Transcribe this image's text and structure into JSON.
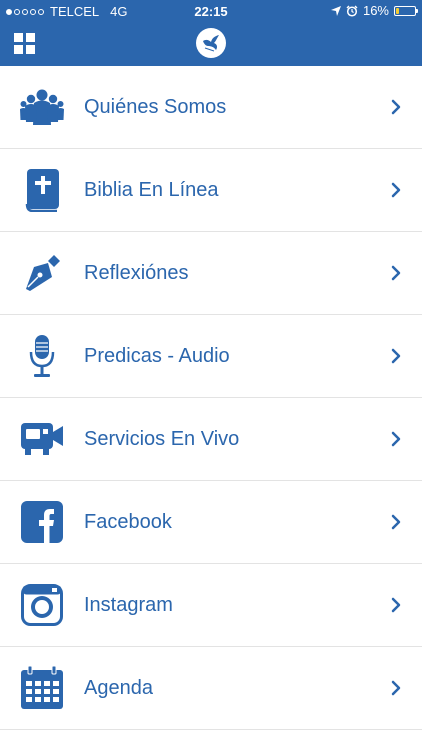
{
  "status_bar": {
    "carrier": "TELCEL",
    "network": "4G",
    "time": "22:15",
    "battery": "16%"
  },
  "header": {
    "menu_icon": "grid-icon",
    "logo_icon": "dove-logo-icon"
  },
  "colors": {
    "brand": "#2b66ad",
    "divider": "#e3e3e3"
  },
  "menu": [
    {
      "label": "Quiénes Somos",
      "icon": "group-icon"
    },
    {
      "label": "Biblia En Línea",
      "icon": "bible-icon"
    },
    {
      "label": "Reflexiónes",
      "icon": "fountain-pen-icon"
    },
    {
      "label": "Predicas - Audio",
      "icon": "microphone-icon"
    },
    {
      "label": "Servicios En Vivo",
      "icon": "video-camera-icon"
    },
    {
      "label": "Facebook",
      "icon": "facebook-icon"
    },
    {
      "label": "Instagram",
      "icon": "instagram-icon"
    },
    {
      "label": "Agenda",
      "icon": "calendar-icon"
    }
  ]
}
